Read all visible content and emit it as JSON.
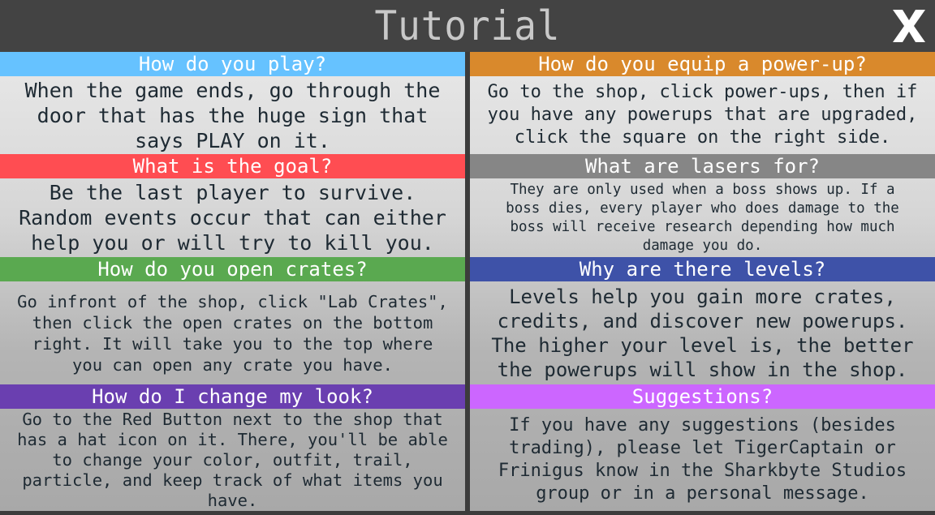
{
  "window": {
    "title": "Tutorial",
    "close_icon": "close-x-icon"
  },
  "colors": {
    "header_bg": "#434343",
    "title_text": "#c8c8c8",
    "body_text": "#1e2a33",
    "play": "#66c2ff",
    "goal": "#ff4d52",
    "crates": "#5aa950",
    "look": "#6a3fb0",
    "powerup": "#d9892c",
    "lasers": "#868686",
    "levels": "#3e52a8",
    "suggestions": "#cc66ff"
  },
  "left": [
    {
      "id": "play",
      "heading": "How do you play?",
      "body": "When the game ends, go through the\ndoor that has the huge sign that\nsays PLAY on it."
    },
    {
      "id": "goal",
      "heading": "What is the goal?",
      "body": "Be the last player to survive.\nRandom events occur that can either\nhelp you or will try to kill you."
    },
    {
      "id": "crates",
      "heading": "How do you open crates?",
      "body": "Go infront of the shop, click \"Lab Crates\",\nthen click the open crates on the bottom\nright. It will take you to the top where\nyou can open any crate you have."
    },
    {
      "id": "look",
      "heading": "How do I change my look?",
      "body": "Go to the Red Button next to the shop that\nhas a hat icon on it. There, you'll be able\nto change your color, outfit, trail,\nparticle, and keep track of what items you\nhave."
    }
  ],
  "right": [
    {
      "id": "powerup",
      "heading": "How do you equip a power-up?",
      "body": "Go to the shop, click power-ups, then if\nyou have any powerups that are upgraded,\nclick the square on the right side."
    },
    {
      "id": "lasers",
      "heading": "What are lasers for?",
      "body": "They are only used when a boss shows up. If a\nboss dies, every player who does damage to the\nboss will receive research depending how much\ndamage you do."
    },
    {
      "id": "levels",
      "heading": "Why are there levels?",
      "body": "Levels help you gain more crates,\ncredits, and discover new powerups.\nThe higher your level is, the better\nthe powerups will show in the shop."
    },
    {
      "id": "suggestions",
      "heading": "Suggestions?",
      "body": "If you have any suggestions (besides\ntrading), please let TigerCaptain or\nFrinigus know in the Sharkbyte Studios\ngroup or in a personal message."
    }
  ]
}
